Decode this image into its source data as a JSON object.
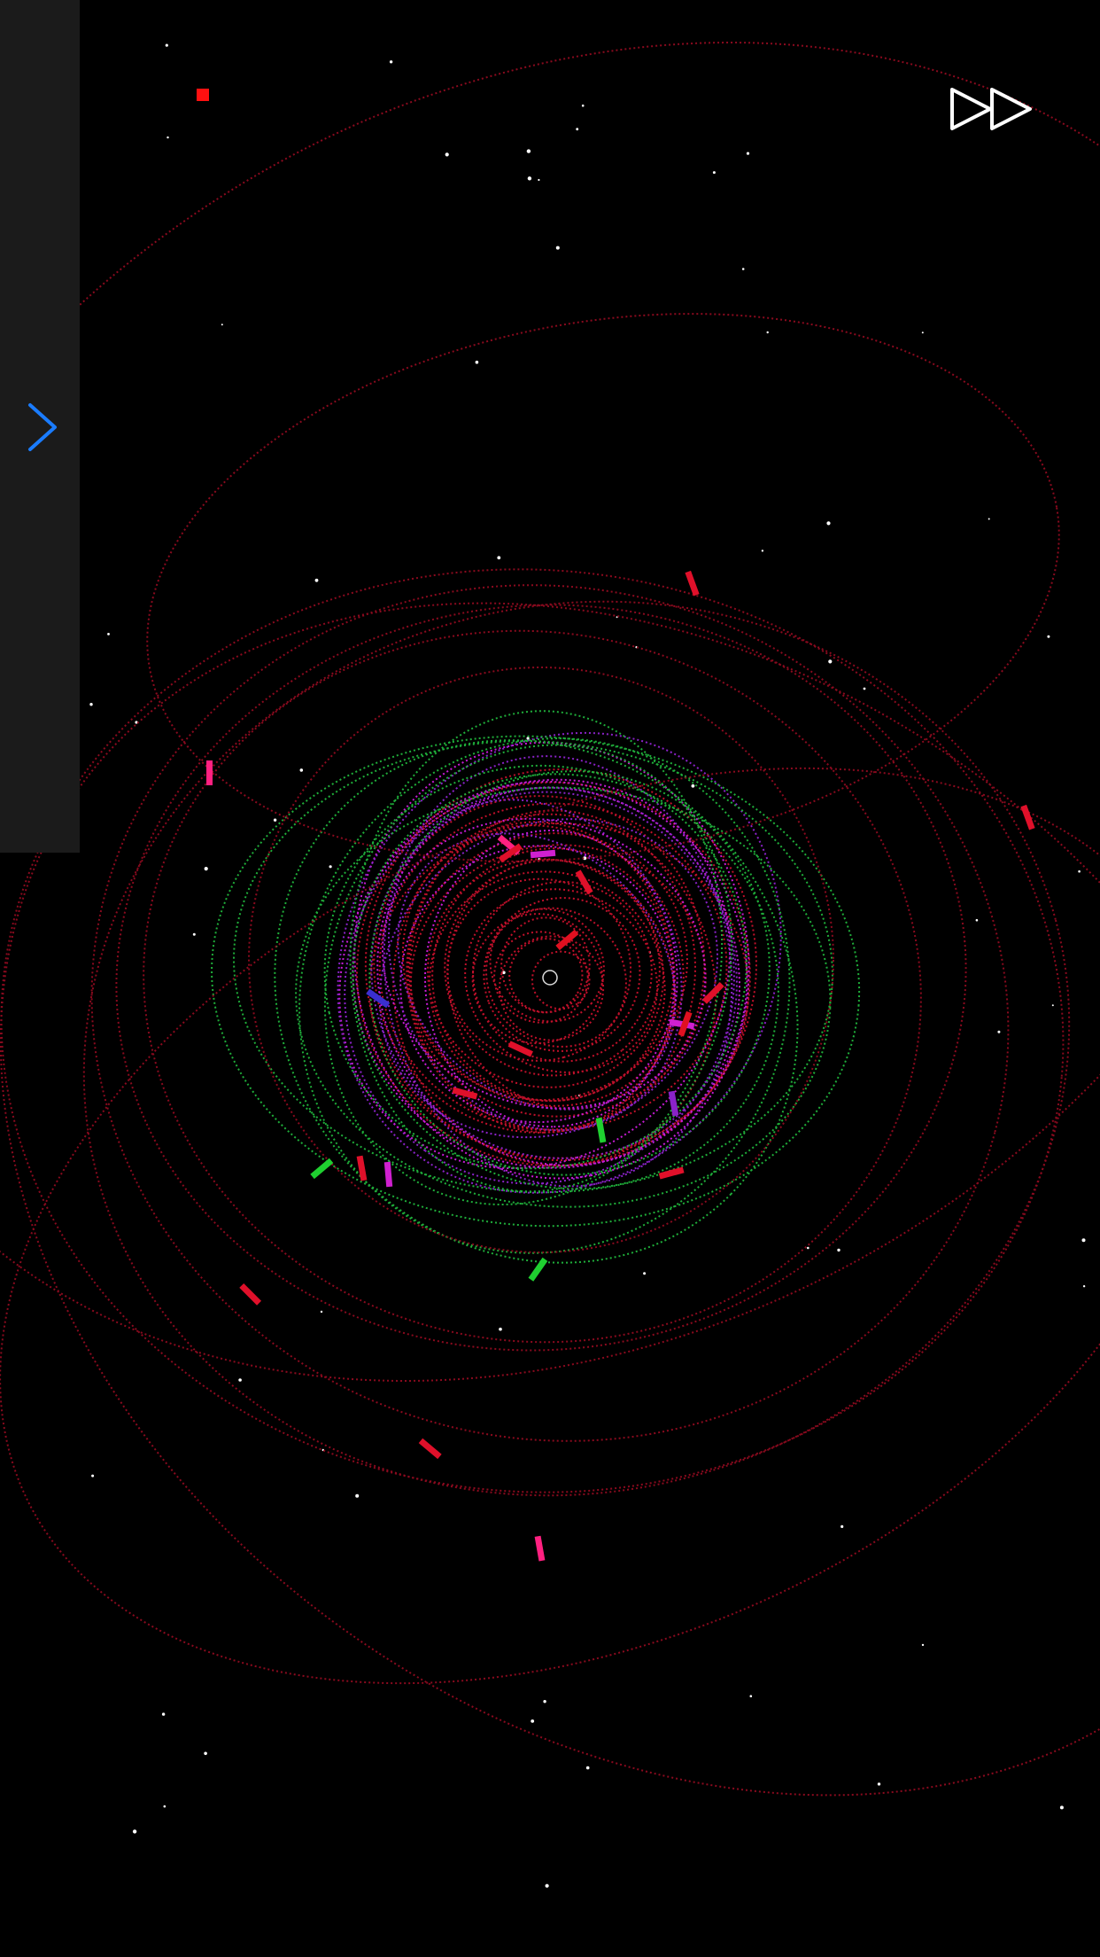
{
  "app": {
    "name": ""
  },
  "sidebar": {
    "collapsed": true,
    "toggle_icon": "chevron-right-icon",
    "accent": "#1a7cff"
  },
  "controls": {
    "fast_forward_icon": "fast-forward-icon"
  },
  "colors": {
    "background": "#000000",
    "sidebar": "#1b1b1b",
    "orbit_red": "#c0102a",
    "orbit_dark_red": "#8a0a1e",
    "orbit_purple": "#8a22c8",
    "orbit_magenta": "#c81bd6",
    "orbit_green": "#1fae3a",
    "orbit_blue": "#3a2fd0",
    "star": "#ffffff"
  },
  "bodies_count": 30
}
